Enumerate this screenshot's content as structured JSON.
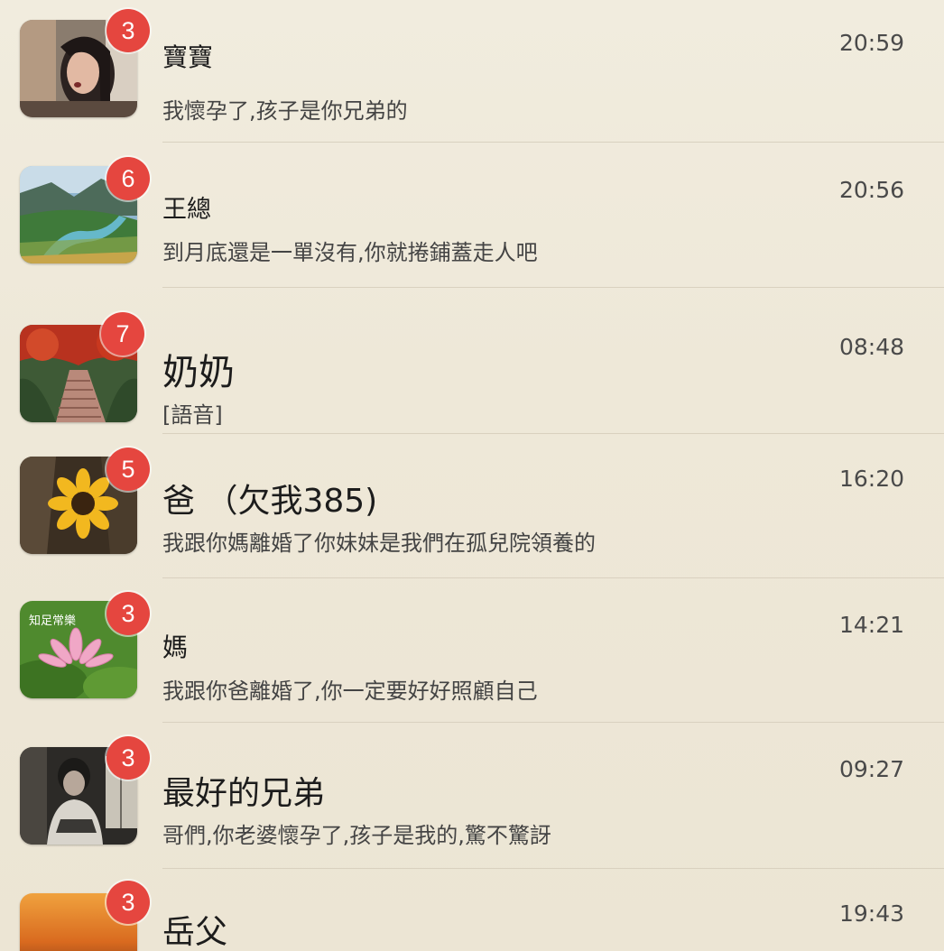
{
  "chats": [
    {
      "name": "寶寶",
      "message": "我懷孕了,孩子是你兄弟的",
      "time": "20:59",
      "unread": "3",
      "avatar": "woman-portrait"
    },
    {
      "name": "王總",
      "message": "到月底還是一單沒有,你就捲鋪蓋走人吧",
      "time": "20:56",
      "unread": "6",
      "avatar": "landscape-river"
    },
    {
      "name": "奶奶",
      "message": "[語音]",
      "time": "08:48",
      "unread": "7",
      "avatar": "autumn-steps"
    },
    {
      "name": "爸 （欠我385)",
      "message": "我跟你媽離婚了你妹妹是我們在孤兒院領養的",
      "time": "16:20",
      "unread": "5",
      "avatar": "sunflower"
    },
    {
      "name": "媽",
      "message": "我跟你爸離婚了,你一定要好好照顧自己",
      "time": "14:21",
      "unread": "3",
      "avatar": "lotus",
      "avatar_text": "知足常樂"
    },
    {
      "name": "最好的兄弟",
      "message": "哥們,你老婆懷孕了,孩子是我的,驚不驚訝",
      "time": "09:27",
      "unread": "3",
      "avatar": "man-portrait"
    },
    {
      "name": "岳父",
      "message": "",
      "time": "19:43",
      "unread": "3",
      "avatar": "sunset"
    }
  ]
}
